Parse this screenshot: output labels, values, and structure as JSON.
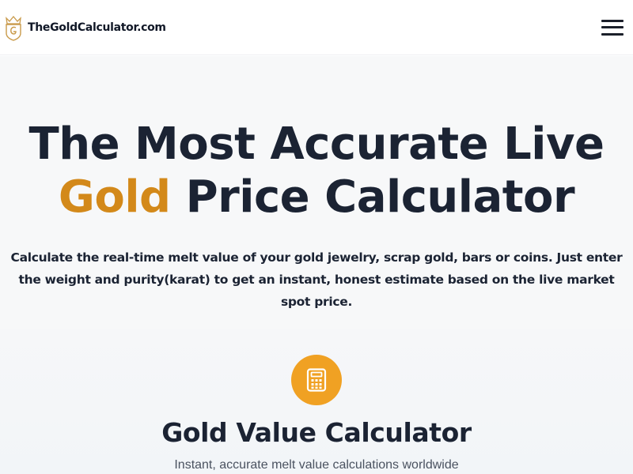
{
  "header": {
    "brand_name": "TheGoldCalculator.com",
    "brand_logo_icon": "gold-crest-logo-icon",
    "menu_icon": "hamburger-menu-icon"
  },
  "hero": {
    "title_line1": "The Most Accurate Live",
    "title_gold_word": "Gold",
    "title_line2_rest": " Price Calculator",
    "description": "Calculate the real-time melt value of your gold jewelry, scrap gold, bars or coins. Just enter the weight and purity(karat) to get an instant, honest estimate based on the live market spot price."
  },
  "calculator": {
    "icon": "calculator-icon",
    "title": "Gold Value Calculator",
    "subtitle": "Instant, accurate melt value calculations worldwide"
  },
  "colors": {
    "accent_gold": "#d3891a",
    "icon_circle": "#f0a123",
    "text_dark": "#1b2333",
    "hero_bg": "#f7f8f9"
  }
}
